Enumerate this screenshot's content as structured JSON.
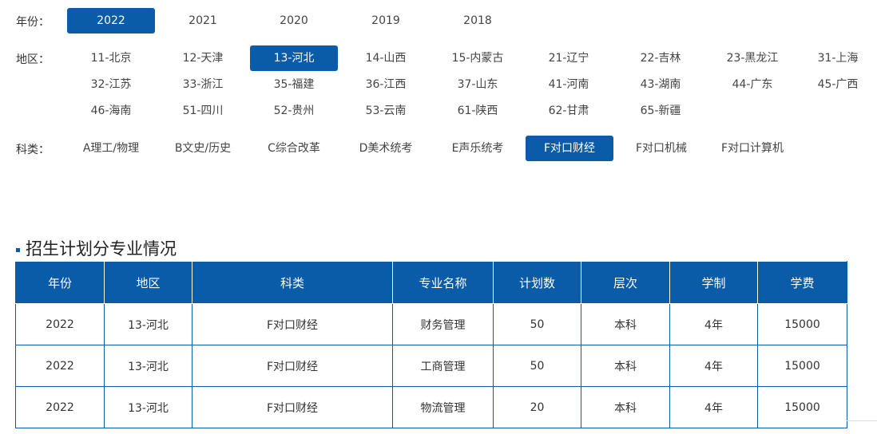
{
  "filters": {
    "year": {
      "label": "年份：",
      "options": [
        "2022",
        "2021",
        "2020",
        "2019",
        "2018"
      ],
      "selected": "2022"
    },
    "region": {
      "label": "地区：",
      "options": [
        "11-北京",
        "12-天津",
        "13-河北",
        "14-山西",
        "15-内蒙古",
        "21-辽宁",
        "22-吉林",
        "23-黑龙江",
        "31-上海",
        "32-江苏",
        "33-浙江",
        "35-福建",
        "36-江西",
        "37-山东",
        "41-河南",
        "43-湖南",
        "44-广东",
        "45-广西",
        "46-海南",
        "51-四川",
        "52-贵州",
        "53-云南",
        "61-陕西",
        "62-甘肃",
        "65-新疆"
      ],
      "selected": "13-河北"
    },
    "category": {
      "label": "科类：",
      "options": [
        "A理工/物理",
        "B文史/历史",
        "C综合改革",
        "D美术统考",
        "E声乐统考",
        "F对口财经",
        "F对口机械",
        "F对口计算机"
      ],
      "selected": "F对口财经"
    }
  },
  "section": {
    "title": "招生计划分专业情况"
  },
  "table": {
    "headers": [
      "年份",
      "地区",
      "科类",
      "专业名称",
      "计划数",
      "层次",
      "学制",
      "学费"
    ],
    "rows": [
      [
        "2022",
        "13-河北",
        "F对口财经",
        "财务管理",
        "50",
        "本科",
        "4年",
        "15000"
      ],
      [
        "2022",
        "13-河北",
        "F对口财经",
        "工商管理",
        "50",
        "本科",
        "4年",
        "15000"
      ],
      [
        "2022",
        "13-河北",
        "F对口财经",
        "物流管理",
        "20",
        "本科",
        "4年",
        "15000"
      ]
    ]
  },
  "colors": {
    "accent": "#0a5ba8"
  }
}
